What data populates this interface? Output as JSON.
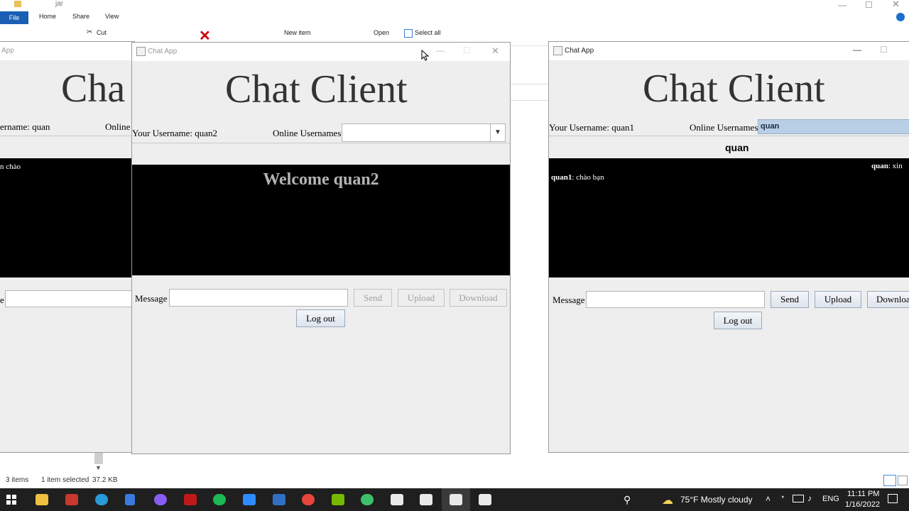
{
  "explorer": {
    "title": "jar",
    "tabs": {
      "file": "File",
      "home": "Home",
      "share": "Share",
      "view": "View"
    },
    "ribbon": {
      "cut": "Cut",
      "new_item": "New item",
      "open": "Open",
      "select_all": "Select all"
    },
    "status": {
      "items": "3 items",
      "selected": "1 item selected",
      "size": "37.2 KB"
    }
  },
  "left_window": {
    "title": "App",
    "heading": "Cha",
    "username_label": "ername: quan",
    "online_label": "Online",
    "chat_line": "n chào",
    "message_label": "e"
  },
  "center_window": {
    "title": "Chat App",
    "heading": "Chat Client",
    "username_label": "Your Username: quan2",
    "online_label": "Online Usernames:",
    "online_value": "",
    "welcome": "Welcome quan2",
    "message_label": "Message",
    "message_value": "",
    "send": "Send",
    "upload": "Upload",
    "download": "Download",
    "logout": "Log out"
  },
  "right_window": {
    "title": "Chat App",
    "heading": "Chat Client",
    "username_label": "Your Username: quan1",
    "online_label": "Online Usernames:",
    "online_value": "quan",
    "chat_target": "quan",
    "msg_right_user": "quan",
    "msg_right_text": ": xin",
    "msg_left_user": "quan1",
    "msg_left_text": ": chào bạn",
    "message_label": "Message",
    "message_value": "",
    "send": "Send",
    "upload": "Upload",
    "download": "Downloa",
    "logout": "Log out"
  },
  "taskbar": {
    "weather": "75°F  Mostly cloudy",
    "lang": "ENG",
    "time": "11:11 PM",
    "date": "1/16/2022",
    "apps": [
      "start-icon",
      "file-explorer-icon",
      "pdf-icon",
      "edge-icon",
      "notepad-icon",
      "github-icon",
      "app-red-icon",
      "spotify-icon",
      "zoom-icon",
      "mail-icon",
      "chrome-icon",
      "nvidia-icon",
      "green-app-icon",
      "java-icon",
      "java-icon",
      "java-icon",
      "java-icon"
    ]
  },
  "colors": {
    "explorer_accent": "#1a5fb4",
    "window_bg": "#eeeeee",
    "chat_bg": "#000000",
    "selection": "#b8cfe5"
  }
}
